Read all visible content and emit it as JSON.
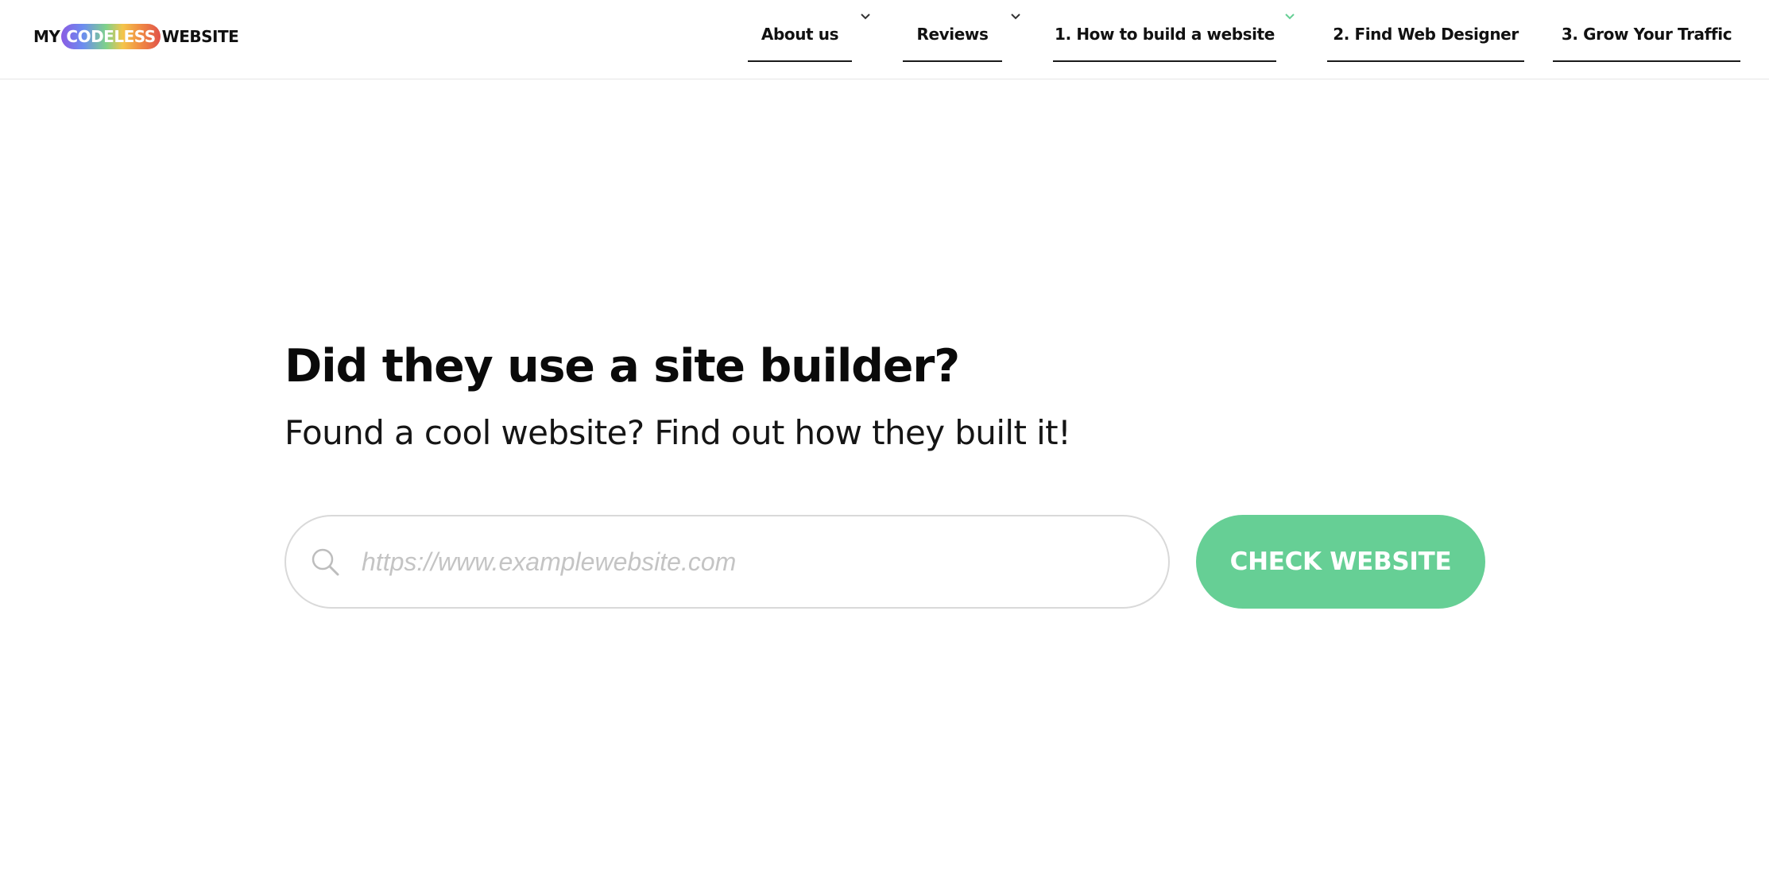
{
  "logo": {
    "prefix": "MY",
    "highlight": "CODELESS",
    "suffix": "WEBSITE"
  },
  "nav": {
    "items": [
      {
        "label": "About us",
        "has_dropdown": true
      },
      {
        "label": "Reviews",
        "has_dropdown": true
      },
      {
        "label": "1. How to build a website",
        "has_dropdown": true
      },
      {
        "label": "2. Find Web Designer",
        "has_dropdown": false
      },
      {
        "label": "3. Grow Your Traffic",
        "has_dropdown": false
      }
    ]
  },
  "hero": {
    "title": "Did they use a site builder?",
    "subtitle": "Found a cool website? Find out how they built it!"
  },
  "search": {
    "placeholder": "https://www.examplewebsite.com",
    "value": "",
    "icon": "search-icon"
  },
  "cta": {
    "label": "CHECK WEBSITE"
  },
  "colors": {
    "accent": "#66cf95",
    "chevron_default": "#333333",
    "chevron_active": "#66cf95",
    "text": "#111111"
  }
}
